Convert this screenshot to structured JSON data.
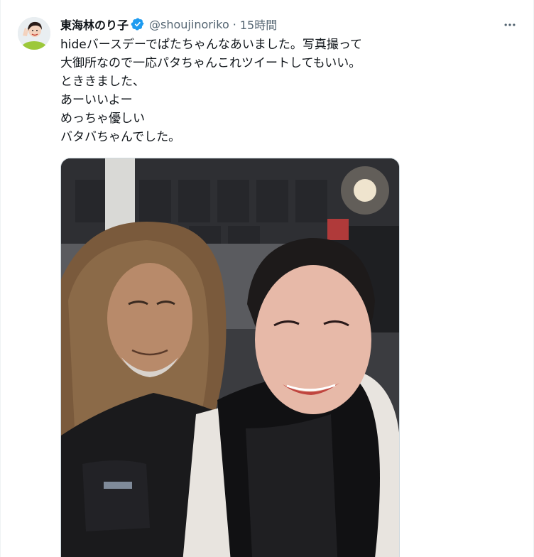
{
  "tweet": {
    "display_name": "東海林のり子",
    "handle": "@shoujinoriko",
    "separator": "·",
    "time": "15時間",
    "text_lines": [
      "hideバースデーでぱたちゃんなあいました。写真撮って",
      "大御所なので一応パタちゃんこれツイートしてもいい。",
      "とききました、",
      "あーいいよー",
      "めっちゃ優しい",
      "バタバちゃんでした。"
    ]
  },
  "icons": {
    "avatar": "avatar",
    "verified": "verified-badge-icon",
    "more": "more-options-icon"
  },
  "colors": {
    "primary_text": "#0f1419",
    "secondary_text": "#536471",
    "verified_blue": "#1d9bf0",
    "border": "#cfd9de"
  }
}
